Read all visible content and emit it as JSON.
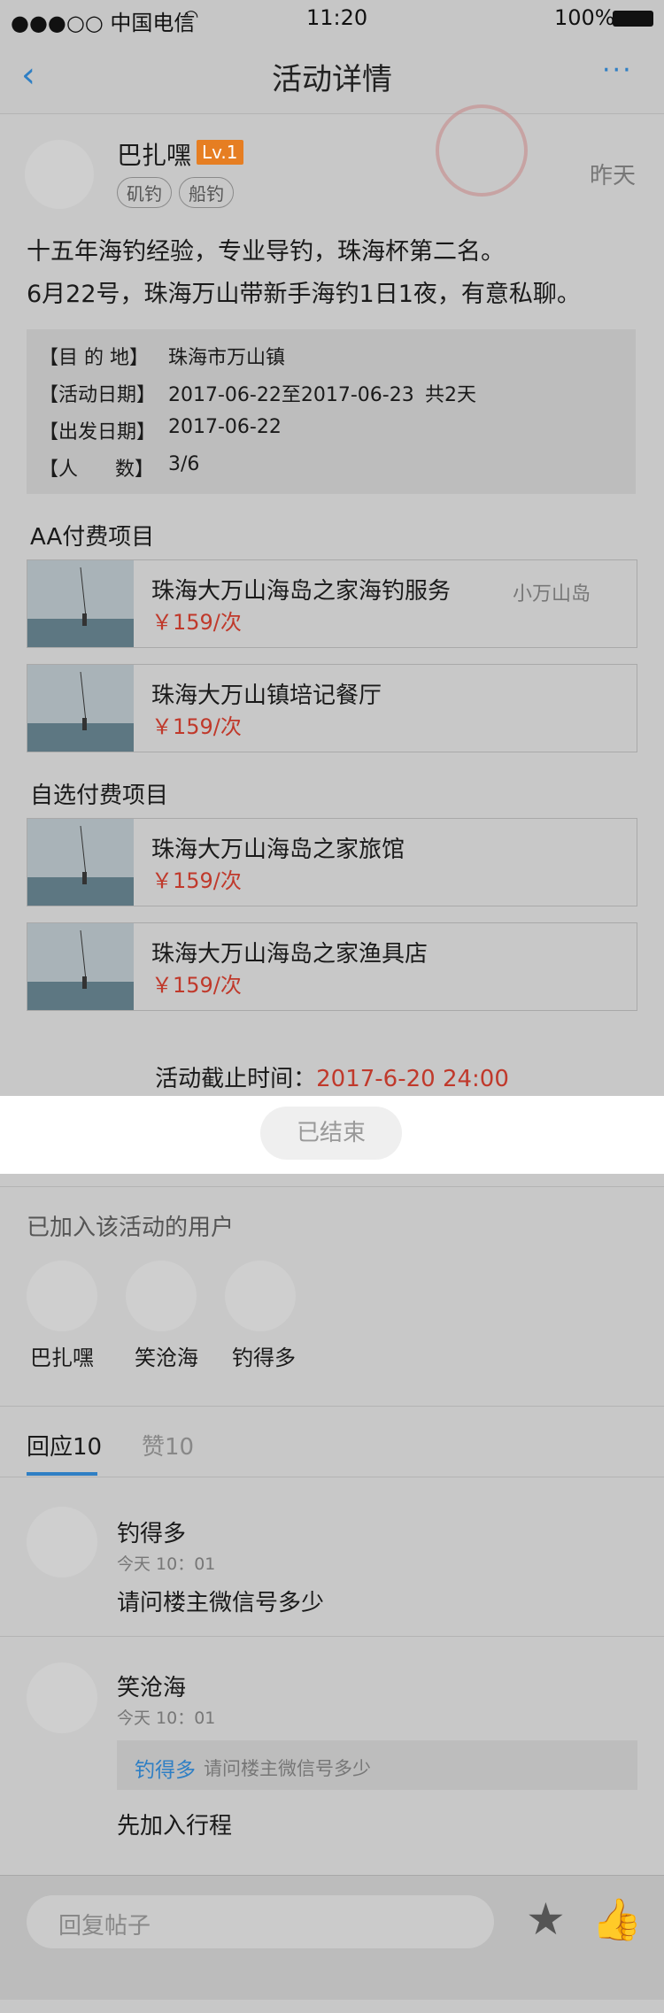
{
  "status": {
    "carrier": "●●●○○ 中国电信",
    "time": "11:20",
    "battery": "100%"
  },
  "nav": {
    "title": "活动详情"
  },
  "post": {
    "username": "巴扎嘿",
    "level": "Lv.1",
    "tags": [
      "矶钓",
      "船钓"
    ],
    "time": "昨天",
    "content_line1": "十五年海钓经验，专业导钓，珠海杯第二名。",
    "content_line2": "6月22号，珠海万山带新手海钓1日1夜，有意私聊。"
  },
  "info": {
    "dest_label": "【目 的 地】",
    "dest_value": "珠海市万山镇",
    "date_label": "【活动日期】",
    "date_value": "2017-06-22至2017-06-23",
    "days": "共2天",
    "depart_label": "【出发日期】",
    "depart_value": "2017-06-22",
    "people_label": "【人      数】",
    "people_value": "3/6"
  },
  "aa_section": {
    "title": "AA付费项目",
    "items": [
      {
        "title": "珠海大万山海岛之家海钓服务",
        "extra": "小万山岛",
        "price": "￥159/次"
      },
      {
        "title": "珠海大万山镇培记餐厅",
        "extra": "",
        "price": "￥159/次"
      }
    ]
  },
  "optional_section": {
    "title": "自选付费项目",
    "items": [
      {
        "title": "珠海大万山海岛之家旅馆",
        "price": "￥159/次"
      },
      {
        "title": "珠海大万山海岛之家渔具店",
        "price": "￥159/次"
      }
    ]
  },
  "deadline": {
    "label": "活动截止时间：",
    "value": "2017-6-20 24:00"
  },
  "ended_button": "已结束",
  "joined": {
    "title": "已加入该活动的用户",
    "users": [
      {
        "name": "巴扎嘿"
      },
      {
        "name": "笑沧海"
      },
      {
        "name": "钓得多"
      }
    ]
  },
  "tabs": {
    "replies": "回应10",
    "likes": "赞10"
  },
  "comments": [
    {
      "name": "钓得多",
      "time": "今天 10：01",
      "text": "请问楼主微信号多少"
    },
    {
      "name": "笑沧海",
      "time": "今天 10：01",
      "quote_name": "钓得多",
      "quote_text": "请问楼主微信号多少",
      "text": "先加入行程"
    }
  ],
  "reply_bar": {
    "placeholder": "回复帖子"
  },
  "colors": {
    "accent": "#2f7fc4",
    "price": "#c0392b",
    "level_badge": "#e67e22"
  }
}
